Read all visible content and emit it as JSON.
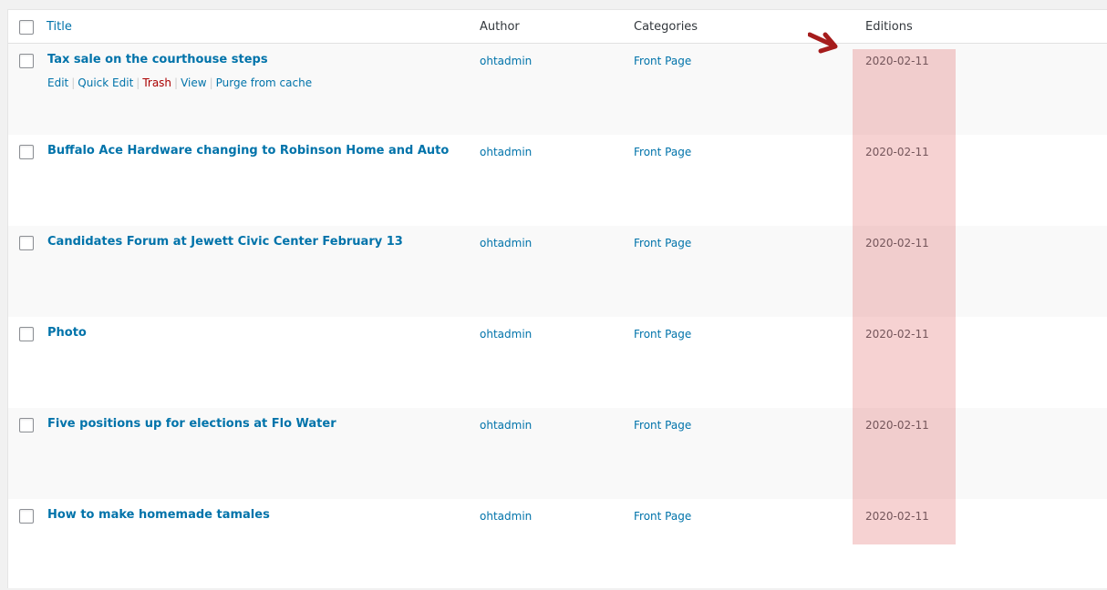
{
  "header": {
    "title": "Title",
    "author": "Author",
    "categories": "Categories",
    "editions": "Editions"
  },
  "row_actions": {
    "edit": "Edit",
    "quick_edit": "Quick Edit",
    "trash": "Trash",
    "view": "View",
    "purge": "Purge from cache"
  },
  "rows": [
    {
      "title": "Tax sale on the courthouse steps",
      "author": "ohtadmin",
      "category": "Front Page",
      "edition": "2020-02-11"
    },
    {
      "title": "Buffalo Ace Hardware changing to Robinson Home and Auto",
      "author": "ohtadmin",
      "category": "Front Page",
      "edition": "2020-02-11"
    },
    {
      "title": "Candidates Forum at Jewett Civic Center February 13",
      "author": "ohtadmin",
      "category": "Front Page",
      "edition": "2020-02-11"
    },
    {
      "title": "Photo",
      "author": "ohtadmin",
      "category": "Front Page",
      "edition": "2020-02-11"
    },
    {
      "title": "Five positions up for elections at Flo Water",
      "author": "ohtadmin",
      "category": "Front Page",
      "edition": "2020-02-11"
    },
    {
      "title": "How to make homemade tamales",
      "author": "ohtadmin",
      "category": "Front Page",
      "edition": "2020-02-11"
    }
  ],
  "annotation": {
    "highlight_color": "#e8a0a0",
    "arrow_color": "#a51c1c",
    "arrow_icon": "arrow-down-right-icon"
  }
}
